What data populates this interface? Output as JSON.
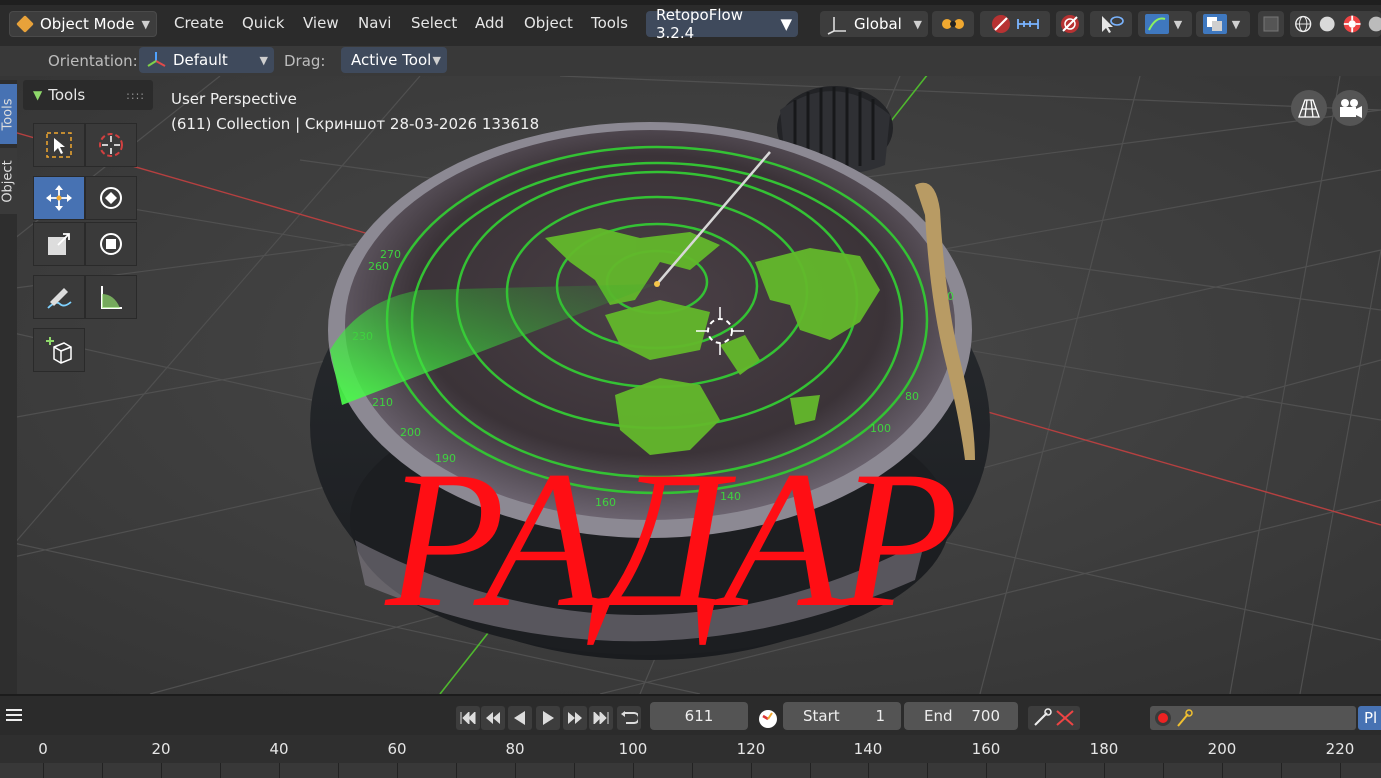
{
  "header": {
    "mode": "Object Mode",
    "menus": [
      "Create",
      "Quick",
      "View",
      "Navi",
      "Select",
      "Add",
      "Object",
      "Tools"
    ],
    "addon": "RetopoFlow 3.2.4",
    "transform_orientation": "Global"
  },
  "tool_settings": {
    "orientation_label": "Orientation:",
    "orientation_value": "Default",
    "drag_label": "Drag:",
    "drag_value": "Active Tool"
  },
  "sidebar_tabs": [
    "Tools",
    "Object"
  ],
  "toolbar": {
    "title": "Tools",
    "tools": [
      "select-box",
      "cursor",
      "move",
      "rotate",
      "scale",
      "transform",
      "annotate",
      "measure",
      "add-cube"
    ],
    "active_tool": "move"
  },
  "viewport": {
    "perspective": "User Perspective",
    "collection": "(611) Collection | Скриншот 28-03-2026 133618",
    "overlay_title": "РАДАР",
    "dial_numbers": [
      "140",
      "160",
      "190",
      "200",
      "210",
      "230",
      "260",
      "270",
      "30",
      "60",
      "80",
      "100"
    ]
  },
  "timeline": {
    "current_frame": "611",
    "start_label": "Start",
    "start_value": "1",
    "end_label": "End",
    "end_value": "700",
    "playback_label": "Pl",
    "ruler": [
      "0",
      "20",
      "40",
      "60",
      "80",
      "100",
      "120",
      "140",
      "160",
      "180",
      "200",
      "220"
    ]
  },
  "colors": {
    "accent": "#4772b3",
    "radar_green": "#3fd33f",
    "title_red": "#ff0e14"
  }
}
